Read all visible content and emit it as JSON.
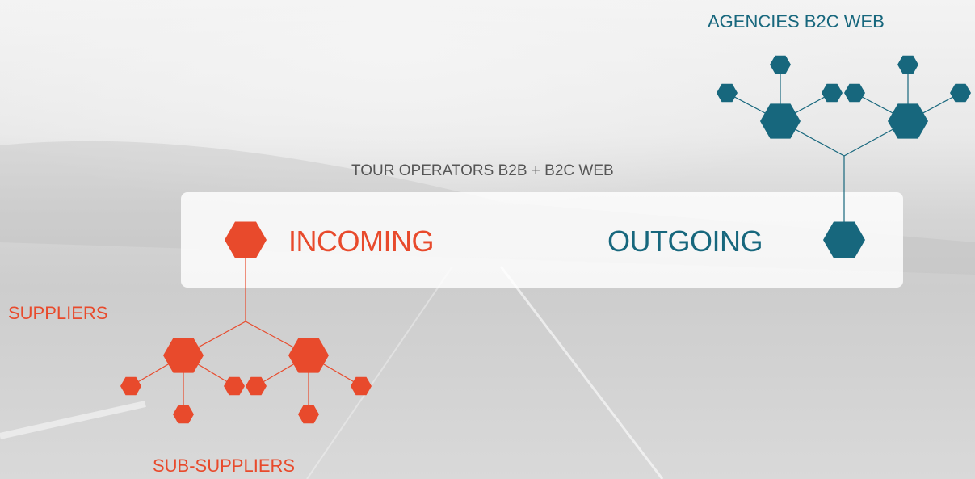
{
  "labels": {
    "agencies": "AGENCIES B2C WEB",
    "tour_operators": "TOUR OPERATORS B2B + B2C WEB",
    "incoming": "INCOMING",
    "outgoing": "OUTGOING",
    "suppliers": "SUPPLIERS",
    "sub_suppliers": "SUB-SUPPLIERS"
  },
  "colors": {
    "incoming": "#e84a2c",
    "outgoing": "#17677d"
  }
}
